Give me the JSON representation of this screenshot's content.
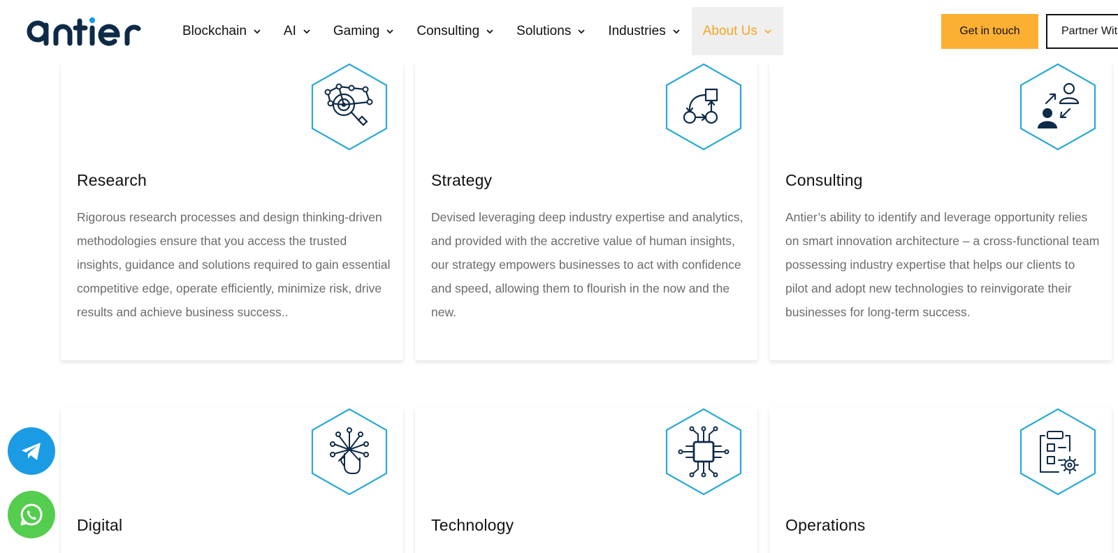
{
  "header": {
    "logo_text": "antier",
    "nav": [
      {
        "label": "Blockchain"
      },
      {
        "label": "AI"
      },
      {
        "label": "Gaming"
      },
      {
        "label": "Consulting"
      },
      {
        "label": "Solutions"
      },
      {
        "label": "Industries"
      },
      {
        "label": "About Us",
        "active": true
      }
    ],
    "cta_label": "Get in touch",
    "partner_label": "Partner With Us"
  },
  "cards": [
    {
      "title": "Research",
      "icon": "research-icon",
      "text": "Rigorous research processes and design thinking-driven methodologies ensure that you access the trusted insights, guidance and solutions required to gain essential competitive edge, operate efficiently, minimize risk, drive results and achieve business success.."
    },
    {
      "title": "Strategy",
      "icon": "strategy-icon",
      "text": "Devised leveraging deep industry expertise and analytics, and provided with the accretive value of human insights, our strategy empowers businesses to act with confidence and speed, allowing them to flourish in the now and the new."
    },
    {
      "title": "Consulting",
      "icon": "consulting-icon",
      "text": "Antier’s ability to identify and leverage opportunity relies on smart innovation architecture – a cross-functional team possessing industry expertise that helps our clients to pilot and adopt new technologies to reinvigorate their businesses for long-term success."
    },
    {
      "title": "Digital",
      "icon": "digital-icon",
      "text": ""
    },
    {
      "title": "Technology",
      "icon": "technology-icon",
      "text": ""
    },
    {
      "title": "Operations",
      "icon": "operations-icon",
      "text": ""
    }
  ],
  "colors": {
    "accent": "#fbb034",
    "active_nav_text": "#f5a623",
    "hex_border": "#29a8d8",
    "icon_stroke": "#0e2a47",
    "telegram": "#1b9be4",
    "whatsapp": "#55cd4f"
  }
}
